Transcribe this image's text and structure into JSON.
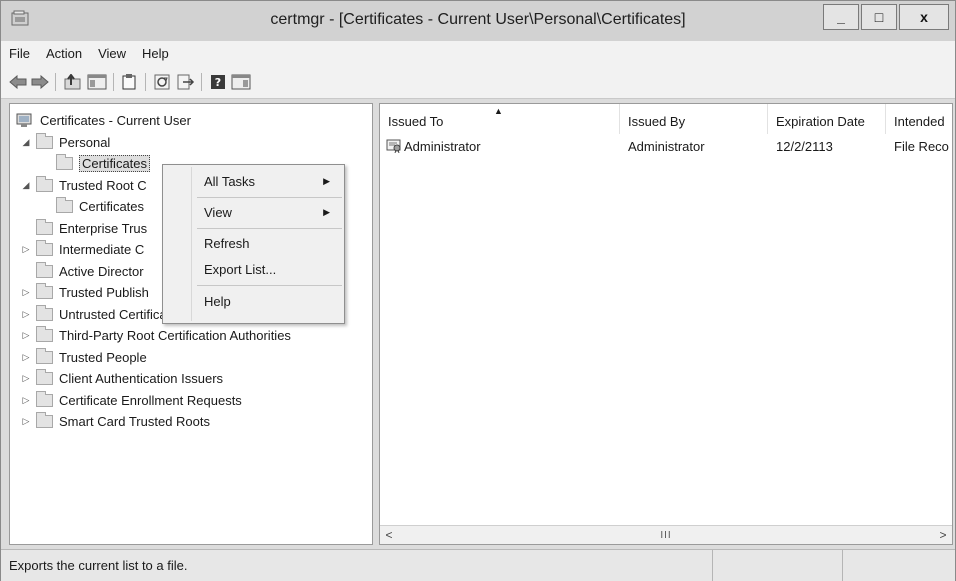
{
  "window": {
    "title": "certmgr - [Certificates - Current User\\Personal\\Certificates]",
    "minimize_label": "_",
    "maximize_label": "□",
    "close_label": "x"
  },
  "menu": [
    "File",
    "Action",
    "View",
    "Help"
  ],
  "toolbar": {
    "icons": [
      "back-arrow-icon",
      "forward-arrow-icon",
      "up-folder-icon",
      "show-hide-console-tree-icon",
      "properties-icon",
      "refresh-icon",
      "export-list-icon",
      "help-icon",
      "show-hide-action-pane-icon"
    ]
  },
  "tree": {
    "root": "Certificates - Current User",
    "items": [
      {
        "label": "Personal",
        "expander": "◢"
      },
      {
        "label": "Certificates",
        "expander": ""
      },
      {
        "label": "Trusted Root C",
        "expander": "◢"
      },
      {
        "label": "Certificates",
        "expander": ""
      },
      {
        "label": "Enterprise Trus",
        "expander": ""
      },
      {
        "label": "Intermediate C",
        "expander": "▷"
      },
      {
        "label": "Active Director",
        "expander": ""
      },
      {
        "label": "Trusted Publish",
        "expander": "▷"
      },
      {
        "label": "Untrusted Certificates",
        "expander": "▷"
      },
      {
        "label": "Third-Party Root Certification Authorities",
        "expander": "▷"
      },
      {
        "label": "Trusted People",
        "expander": "▷"
      },
      {
        "label": "Client Authentication Issuers",
        "expander": "▷"
      },
      {
        "label": "Certificate Enrollment Requests",
        "expander": "▷"
      },
      {
        "label": "Smart Card Trusted Roots",
        "expander": "▷"
      }
    ]
  },
  "list": {
    "columns": [
      "Issued To",
      "Issued By",
      "Expiration Date",
      "Intended"
    ],
    "sort_indicator": "▲",
    "rows": [
      {
        "issued_to": "Administrator",
        "issued_by": "Administrator",
        "expiration": "12/2/2113",
        "intended": "File Reco"
      }
    ],
    "scroll_left": "<",
    "scroll_right": ">",
    "scroll_grip": "III"
  },
  "context_menu": {
    "items": [
      "All Tasks",
      "View",
      "Refresh",
      "Export List...",
      "Help"
    ],
    "submenu_arrow": "▶"
  },
  "status": {
    "text": "Exports the current list to a file."
  },
  "colors": {
    "selection": "#dedede",
    "window_bg": "#dcdcdc",
    "pane_bg": "#ffffff"
  }
}
